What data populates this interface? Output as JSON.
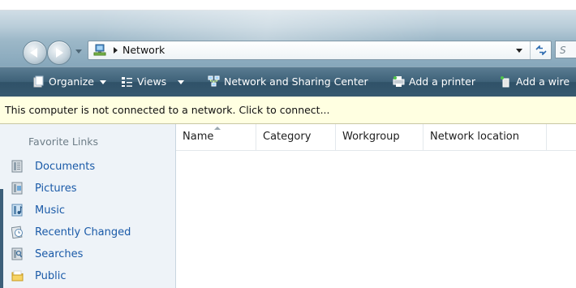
{
  "address_bar": {
    "location": "Network",
    "search_placeholder": "S"
  },
  "toolbar": {
    "organize": "Organize",
    "views": "Views",
    "network_sharing": "Network and Sharing Center",
    "add_printer": "Add a printer",
    "add_wireless": "Add a wire"
  },
  "info_bar": {
    "message": "This computer is not connected to a network. Click to connect..."
  },
  "sidebar": {
    "title": "Favorite Links",
    "items": [
      {
        "label": "Documents",
        "icon": "documents-icon"
      },
      {
        "label": "Pictures",
        "icon": "pictures-icon"
      },
      {
        "label": "Music",
        "icon": "music-icon"
      },
      {
        "label": "Recently Changed",
        "icon": "recently-changed-icon"
      },
      {
        "label": "Searches",
        "icon": "searches-icon"
      },
      {
        "label": "Public",
        "icon": "public-folder-icon"
      }
    ]
  },
  "columns": [
    "Name",
    "Category",
    "Workgroup",
    "Network location"
  ],
  "colors": {
    "toolbar": "#3e6178",
    "info_bar": "#ffffe1",
    "link": "#1a5aa8",
    "sidebar": "#eef3f8"
  }
}
